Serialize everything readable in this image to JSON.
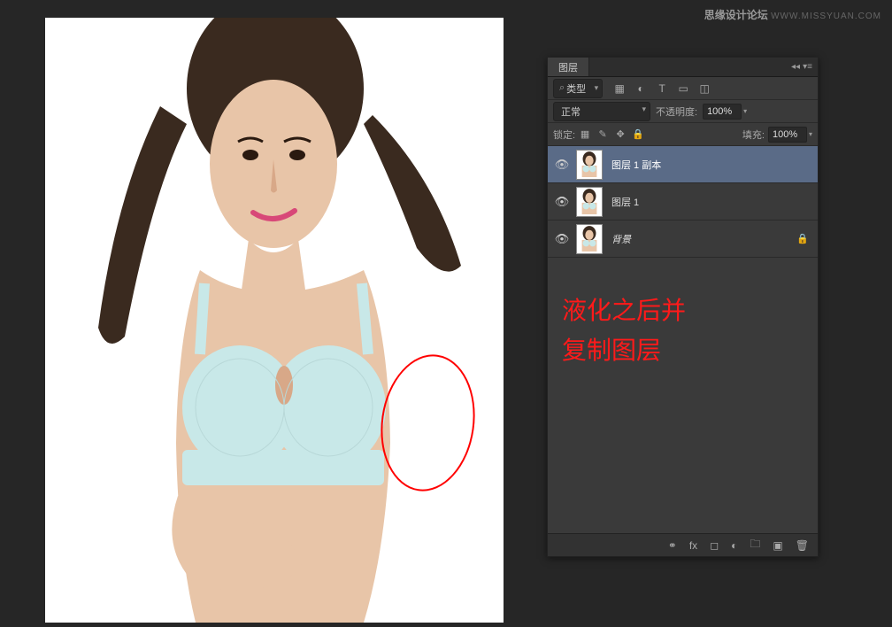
{
  "watermark": {
    "brand": "思缘设计论坛",
    "url": "WWW.MISSYUAN.COM"
  },
  "annotation": {
    "line1": "液化之后并",
    "line2": "复制图层"
  },
  "panel": {
    "title": "图层",
    "filter": {
      "kind": "类型"
    },
    "blend": {
      "mode": "正常",
      "opacity_label": "不透明度:",
      "opacity_value": "100%"
    },
    "lock": {
      "label": "锁定:",
      "fill_label": "填充:",
      "fill_value": "100%"
    },
    "layers": [
      {
        "name": "图层 1 副本",
        "selected": true,
        "locked": false
      },
      {
        "name": "图层 1",
        "selected": false,
        "locked": false
      },
      {
        "name": "背景",
        "selected": false,
        "locked": true
      }
    ]
  }
}
